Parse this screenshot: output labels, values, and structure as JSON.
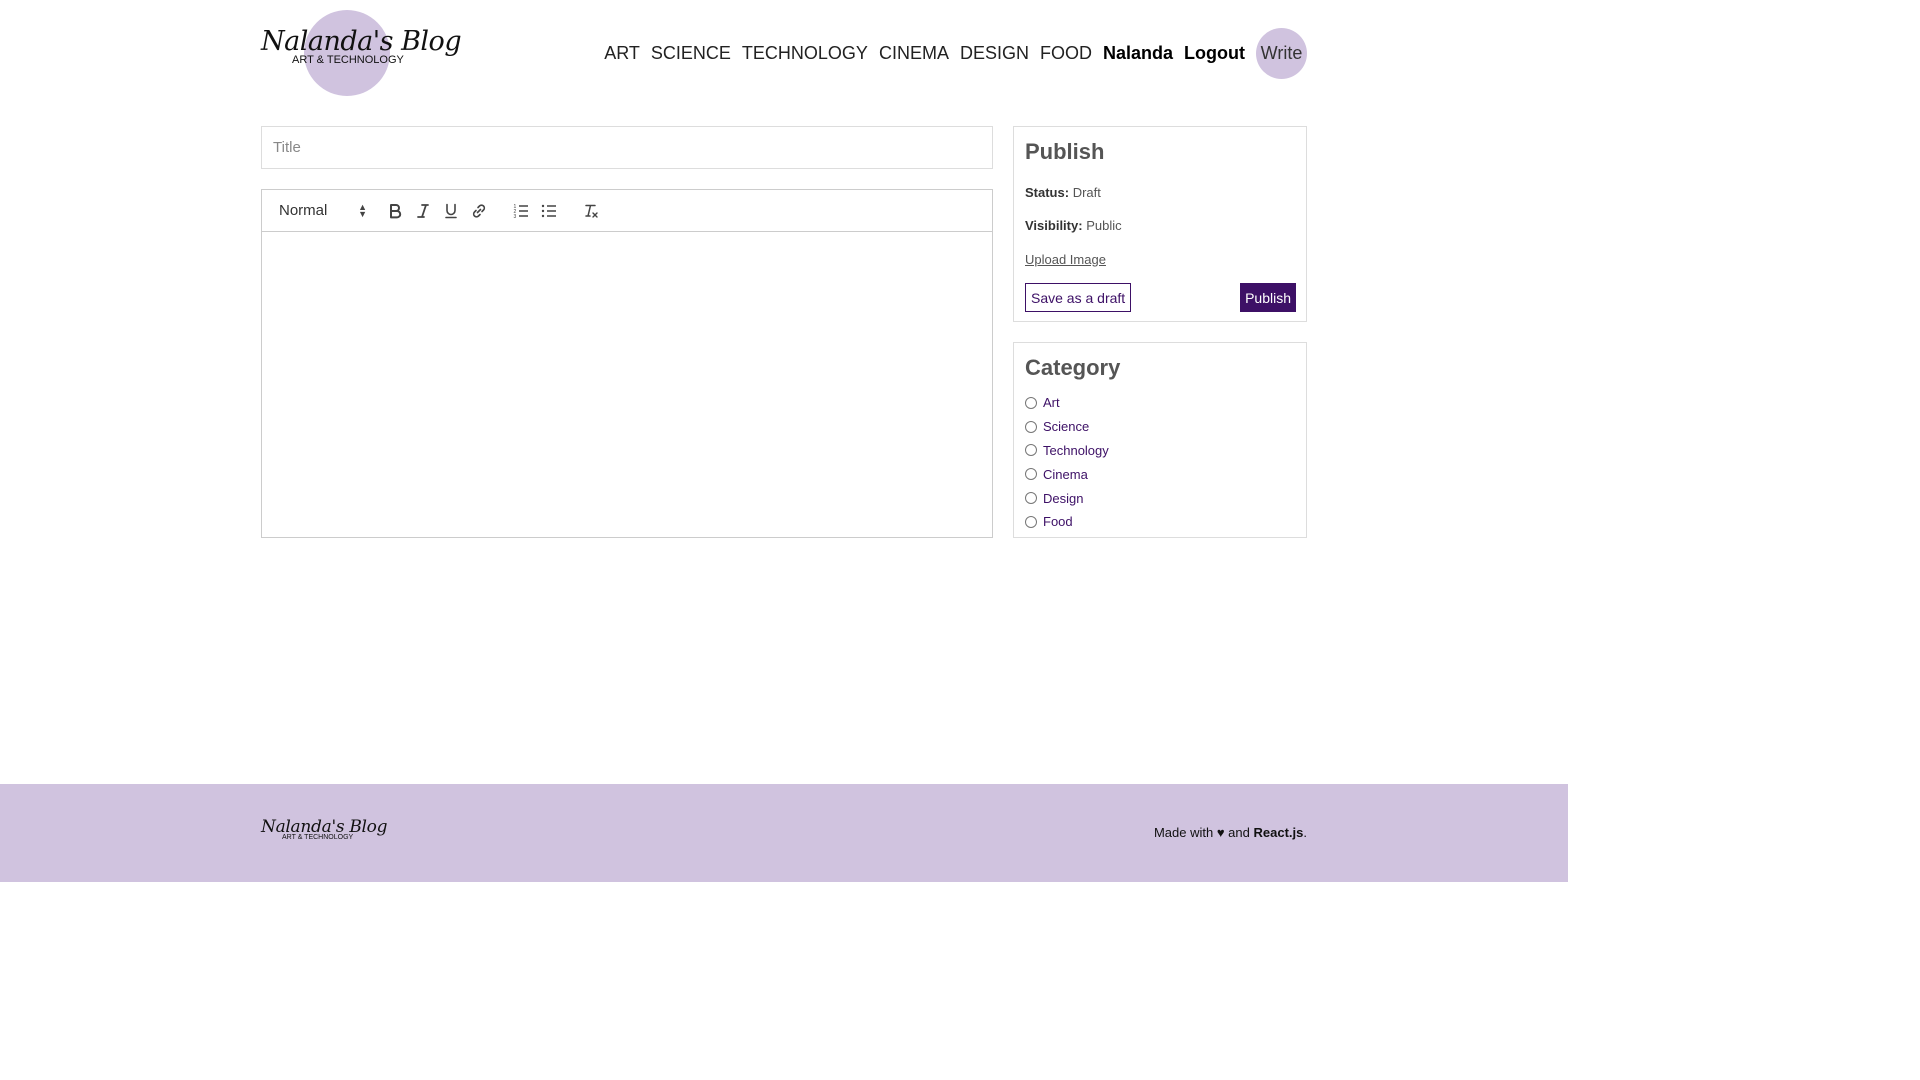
{
  "logo": {
    "title": "Nalanda's Blog",
    "subtitle": "ART & TECHNOLOGY"
  },
  "nav": {
    "links": [
      "ART",
      "SCIENCE",
      "TECHNOLOGY",
      "CINEMA",
      "DESIGN",
      "FOOD"
    ],
    "user": "Nalanda",
    "logout": "Logout",
    "write": "Write"
  },
  "editor": {
    "title_placeholder": "Title",
    "title_value": "",
    "format_select": "Normal",
    "toolbar_icons": [
      "bold-icon",
      "italic-icon",
      "underline-icon",
      "link-icon",
      "ordered-list-icon",
      "bullet-list-icon",
      "clear-format-icon"
    ]
  },
  "publish": {
    "heading": "Publish",
    "status_label": "Status:",
    "status_value": "Draft",
    "visibility_label": "Visibility:",
    "visibility_value": "Public",
    "upload_label": "Upload Image",
    "draft_button": "Save as a draft",
    "publish_button": "Publish"
  },
  "category": {
    "heading": "Category",
    "options": [
      "Art",
      "Science",
      "Technology",
      "Cinema",
      "Design",
      "Food"
    ]
  },
  "footer": {
    "logo_title": "Nalanda's Blog",
    "logo_subtitle": "ART & TECHNOLOGY",
    "made_with": "Made with",
    "heart": "♥",
    "and": "and",
    "framework": "React.js",
    "period": "."
  },
  "colors": {
    "accent": "#3d1066",
    "lavender": "#d0c3df"
  }
}
